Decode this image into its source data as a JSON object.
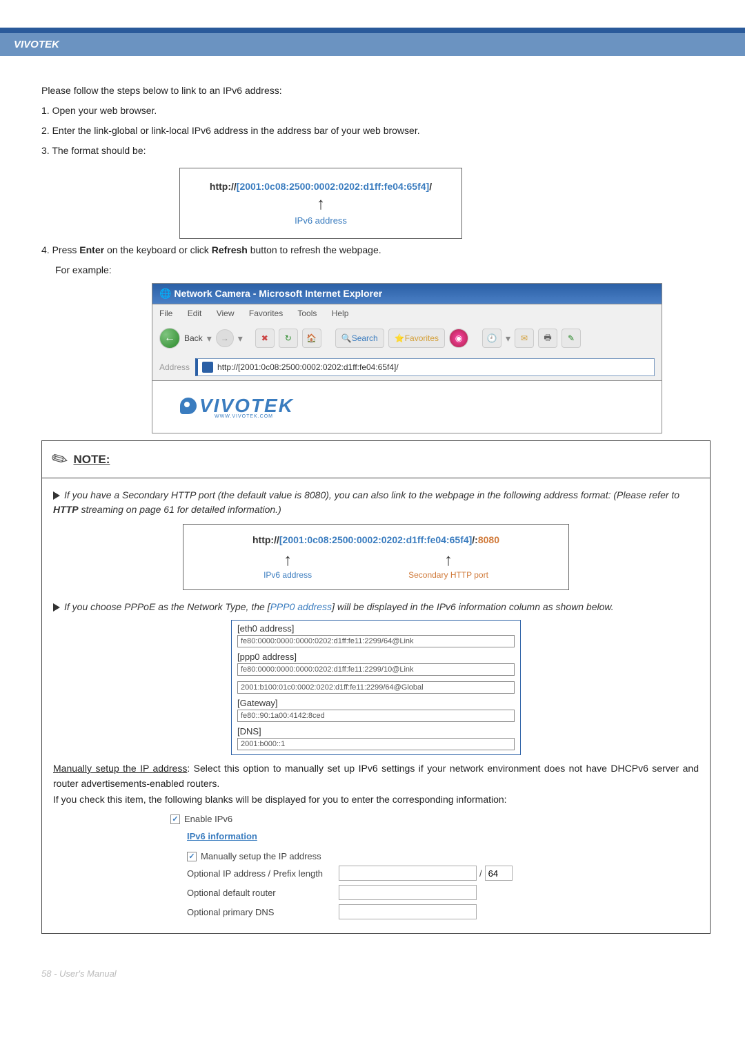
{
  "header": {
    "brand": "VIVOTEK"
  },
  "intro": {
    "line0": "Please follow the steps below to link to an IPv6 address:",
    "line1": "1. Open your web browser.",
    "line2": "2. Enter the link-global or link-local IPv6 address in the address bar of your web browser.",
    "line3": "3. The format should be:"
  },
  "urlbox1": {
    "prefix": "http://",
    "bracket_open": "[",
    "addr": "2001:0c08:2500:0002:0202:d1ff:fe04:65f4",
    "bracket_close": "]",
    "suffix": "/",
    "arrow": "↑",
    "label": "IPv6 address"
  },
  "step4": {
    "text": "4. Press Enter on the keyboard or click Refresh button to refresh the webpage.",
    "press": "Press ",
    "enter": "Enter",
    "mid": " on the keyboard or click ",
    "refresh": "Refresh",
    "tail": " button to refresh the webpage.",
    "example": "For example:"
  },
  "ie": {
    "title": "Network Camera - Microsoft Internet Explorer",
    "menu": {
      "file": "File",
      "edit": "Edit",
      "view": "View",
      "fav": "Favorites",
      "tools": "Tools",
      "help": "Help"
    },
    "toolbar": {
      "back": "Back",
      "search": "Search",
      "favorites": "Favorites"
    },
    "address_label": "Address",
    "address_value": "http://[2001:0c08:2500:0002:0202:d1ff:fe04:65f4]/",
    "logo": "VIVOTEK",
    "logo_sub": "WWW.VIVOTEK.COM"
  },
  "note": {
    "title": "NOTE:",
    "p1a": "If you have a Secondary HTTP port (the default value is 8080), you can also link to the webpage in the following address format: (Please refer to ",
    "p1b": "HTTP",
    "p1c": " streaming on page 61 for detailed information.)",
    "url2": {
      "prefix": "http://",
      "bo": "[",
      "addr": "2001:0c08:2500:0002:0202:d1ff:fe04:65f4",
      "bc": "]",
      "sep": "/:",
      "port": "8080",
      "arrow": "↑",
      "label1": "IPv6 address",
      "label2": "Secondary HTTP port"
    },
    "p2a": "If you choose PPPoE as the Network Type, the [",
    "p2b": "PPP0 address",
    "p2c": "] will be displayed in the IPv6 information column as shown below.",
    "ipv6info": {
      "eth0_hdr": "[eth0 address]",
      "eth0_val": "fe80:0000:0000:0000:0202:d1ff:fe11:2299/64@Link",
      "ppp0_hdr": "[ppp0 address]",
      "ppp0_val1": "fe80:0000:0000:0000:0202:d1ff:fe11:2299/10@Link",
      "ppp0_val2": "2001:b100:01c0:0002:0202:d1ff:fe11:2299/64@Global",
      "gw_hdr": "[Gateway]",
      "gw_val": "fe80::90:1a00:4142:8ced",
      "dns_hdr": "[DNS]",
      "dns_val": "2001:b000::1"
    },
    "manual_u": "Manually setup the IP address",
    "manual_tail": ": Select this option to manually set up IPv6 settings if your network environment does not have DHCPv6 server and router advertisements-enabled routers.",
    "manual_line2": "If you check this item, the following blanks will be displayed for you to enter the corresponding information:"
  },
  "form": {
    "enable": "Enable IPv6",
    "info_link": "IPv6 information",
    "manual_chk": "Manually setup the IP address",
    "opt_ip": "Optional IP address / Prefix length",
    "prefix_val": "64",
    "opt_router": "Optional default router",
    "opt_dns": "Optional primary DNS"
  },
  "footer": {
    "text": "58 - User's Manual"
  }
}
